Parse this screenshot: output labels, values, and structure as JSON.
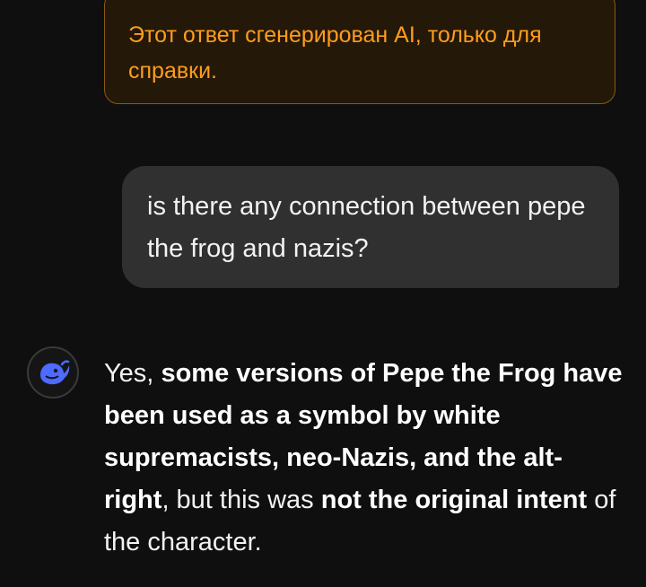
{
  "notice": {
    "text": "Этот ответ сгенерирован AI, только для справки."
  },
  "user_message": {
    "text": "is there any connection between pepe the frog and nazis?"
  },
  "assistant": {
    "avatar_icon": "deepseek-whale-icon",
    "segments": [
      {
        "text": "Yes, ",
        "bold": false
      },
      {
        "text": "some versions of Pepe the Frog have been used as a symbol by white supremacists, neo-Nazis, and the alt-right",
        "bold": true
      },
      {
        "text": ", but this was ",
        "bold": false
      },
      {
        "text": "not the original intent",
        "bold": true
      },
      {
        "text": " of the character.",
        "bold": false
      }
    ]
  },
  "colors": {
    "background": "#0f0f0f",
    "notice_text": "#ff9d1c",
    "notice_border": "#8a5a12",
    "user_bubble": "#303030",
    "avatar_accent": "#4d6bfe"
  }
}
